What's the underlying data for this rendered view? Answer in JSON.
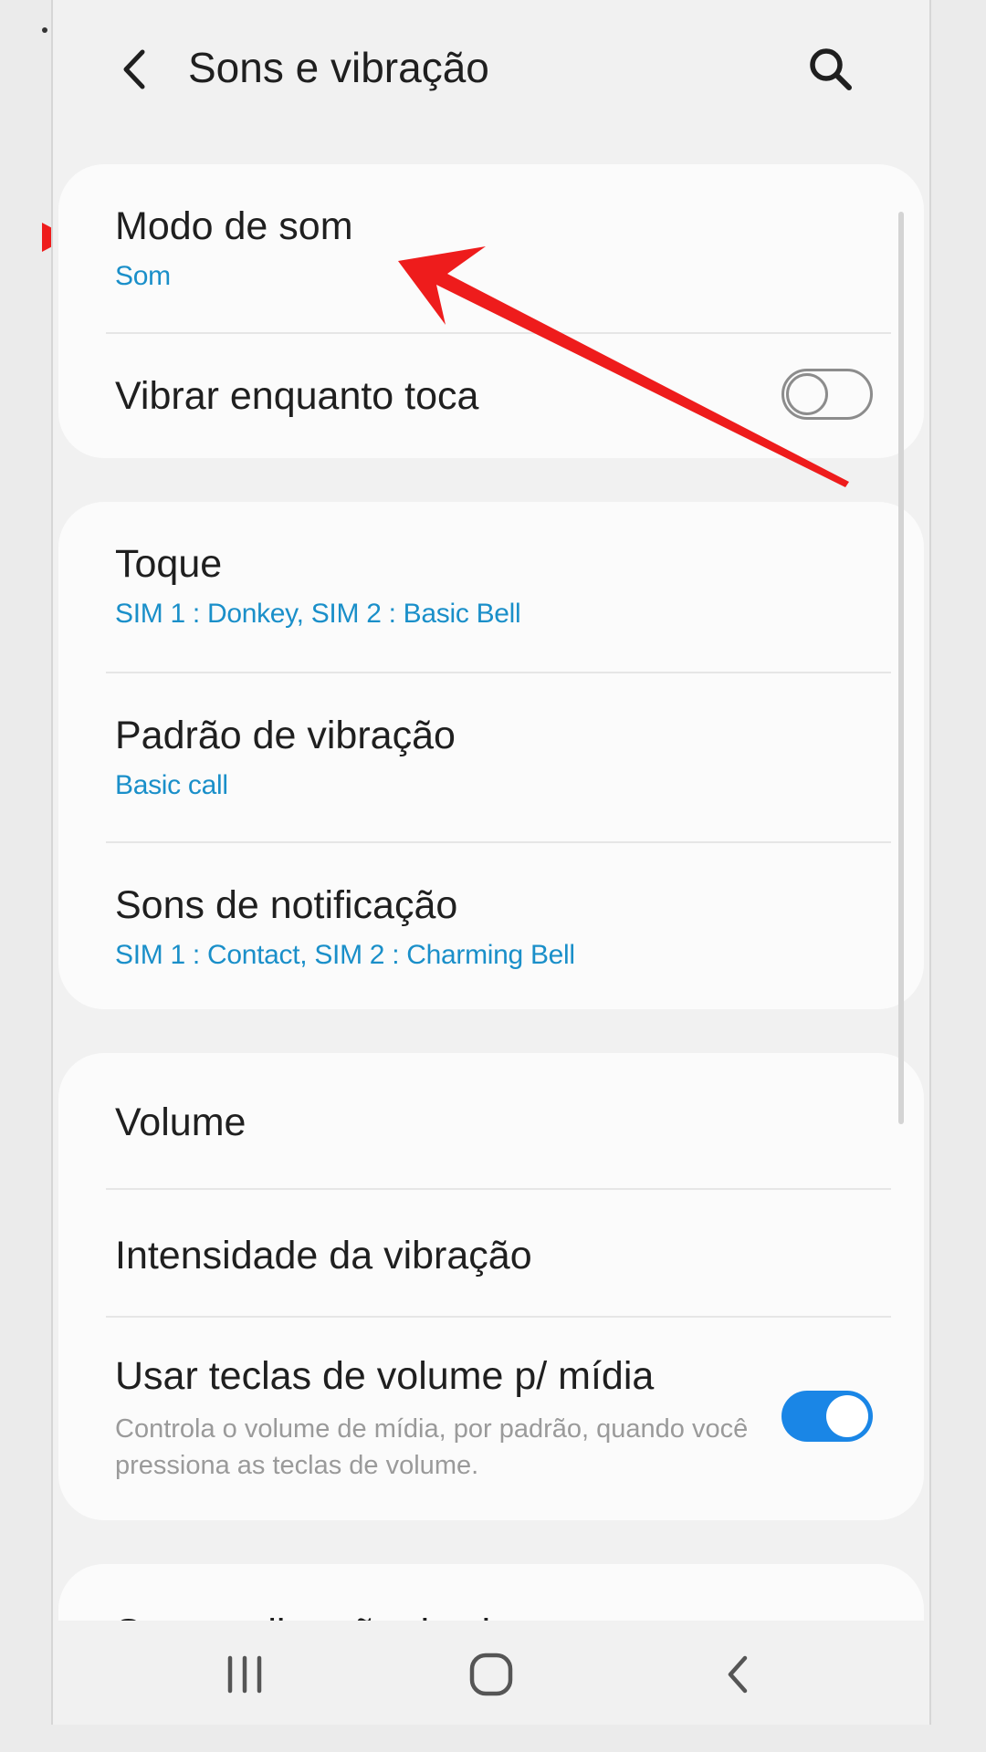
{
  "header": {
    "title": "Sons e vibração",
    "back_icon": "chevron-left-icon",
    "search_icon": "search-icon"
  },
  "groups": [
    {
      "items": [
        {
          "title": "Modo de som",
          "subtitle": "Som"
        },
        {
          "title": "Vibrar enquanto toca",
          "toggle": false
        }
      ]
    },
    {
      "items": [
        {
          "title": "Toque",
          "subtitle": "SIM 1 : Donkey, SIM 2 : Basic Bell"
        },
        {
          "title": "Padrão de vibração",
          "subtitle": "Basic call"
        },
        {
          "title": "Sons de notificação",
          "subtitle": "SIM 1 : Contact, SIM 2 : Charming Bell"
        }
      ]
    },
    {
      "items": [
        {
          "title": "Volume"
        },
        {
          "title": "Intensidade da vibração"
        },
        {
          "title": "Usar teclas de volume p/ mídia",
          "description": "Controla o volume de mídia, por padrão, quando você pressiona as teclas de volume.",
          "toggle": true
        }
      ]
    },
    {
      "items": [
        {
          "title": "Sons e vibração do sistema"
        }
      ]
    }
  ],
  "navbar": {
    "recents_icon": "recents-icon",
    "home_icon": "home-icon",
    "back_icon": "back-icon"
  },
  "colors": {
    "accent": "#1a86e6",
    "subtitle": "#1a8fc9",
    "annotation": "#ee1c1c"
  }
}
